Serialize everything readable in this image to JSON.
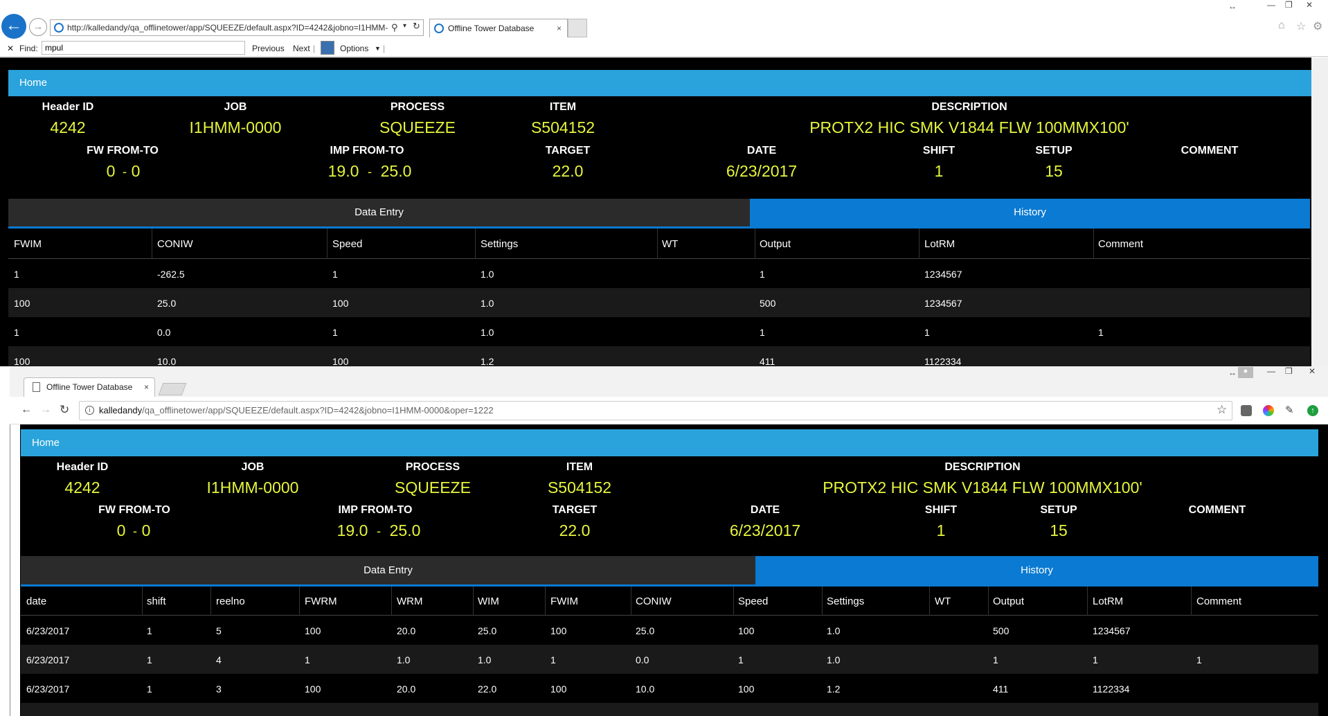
{
  "ie": {
    "url": "http://kalledandy/qa_offlinetower/app/SQUEEZE/default.aspx?ID=4242&jobno=I1HMM-",
    "tab_title": "Offline Tower Database",
    "tab_close": "×",
    "find_label": "Find:",
    "find_value": "mpul",
    "find_close": "✕",
    "previous_label": "Previous",
    "next_label": "Next",
    "options_label": "Options"
  },
  "chrome": {
    "tab_title": "Offline Tower Database",
    "tab_close": "×",
    "url_host": "kalledandy",
    "url_path": "/qa_offlinetower/app/SQUEEZE/default.aspx?ID=4242&jobno=I1HMM-0000&oper=1222"
  },
  "app": {
    "nav_home": "Home",
    "labels": {
      "header_id": "Header ID",
      "job": "JOB",
      "process": "PROCESS",
      "item": "ITEM",
      "description": "DESCRIPTION",
      "fw_from_to": "FW FROM-TO",
      "imp_from_to": "IMP FROM-TO",
      "target": "TARGET",
      "date": "DATE",
      "shift": "SHIFT",
      "setup": "SETUP",
      "comment": "COMMENT"
    },
    "values": {
      "header_id": "4242",
      "job": "I1HMM-0000",
      "process": "SQUEEZE",
      "item": "S504152",
      "description": "PROTX2 HIC SMK V1844 FLW 100MMX100'",
      "fw_from": "0",
      "fw_to": "0",
      "imp_from": "19.0",
      "imp_to": "25.0",
      "target": "22.0",
      "date": "6/23/2017",
      "shift": "1",
      "setup": "15",
      "comment": ""
    },
    "dash": "-",
    "tab_data_entry": "Data Entry",
    "tab_history": "History"
  },
  "table1": {
    "columns": [
      "FWIM",
      "CONIW",
      "Speed",
      "Settings",
      "WT",
      "Output",
      "LotRM",
      "Comment"
    ],
    "rows": [
      [
        "1",
        "-262.5",
        "1",
        "1.0",
        "",
        "1",
        "1234567",
        ""
      ],
      [
        "100",
        "25.0",
        "100",
        "1.0",
        "",
        "500",
        "1234567",
        ""
      ],
      [
        "1",
        "0.0",
        "1",
        "1.0",
        "",
        "1",
        "1",
        "1"
      ],
      [
        "100",
        "10.0",
        "100",
        "1.2",
        "",
        "411",
        "1122334",
        ""
      ]
    ]
  },
  "table2": {
    "columns": [
      "date",
      "shift",
      "reelno",
      "FWRM",
      "WRM",
      "WIM",
      "FWIM",
      "CONIW",
      "Speed",
      "Settings",
      "WT",
      "Output",
      "LotRM",
      "Comment"
    ],
    "rows": [
      [
        "6/23/2017",
        "1",
        "5",
        "100",
        "20.0",
        "25.0",
        "100",
        "25.0",
        "100",
        "1.0",
        "",
        "500",
        "1234567",
        ""
      ],
      [
        "6/23/2017",
        "1",
        "4",
        "1",
        "1.0",
        "1.0",
        "1",
        "0.0",
        "1",
        "1.0",
        "",
        "1",
        "1",
        "1"
      ],
      [
        "6/23/2017",
        "1",
        "3",
        "100",
        "20.0",
        "22.0",
        "100",
        "10.0",
        "100",
        "1.2",
        "",
        "411",
        "1122334",
        ""
      ]
    ]
  }
}
